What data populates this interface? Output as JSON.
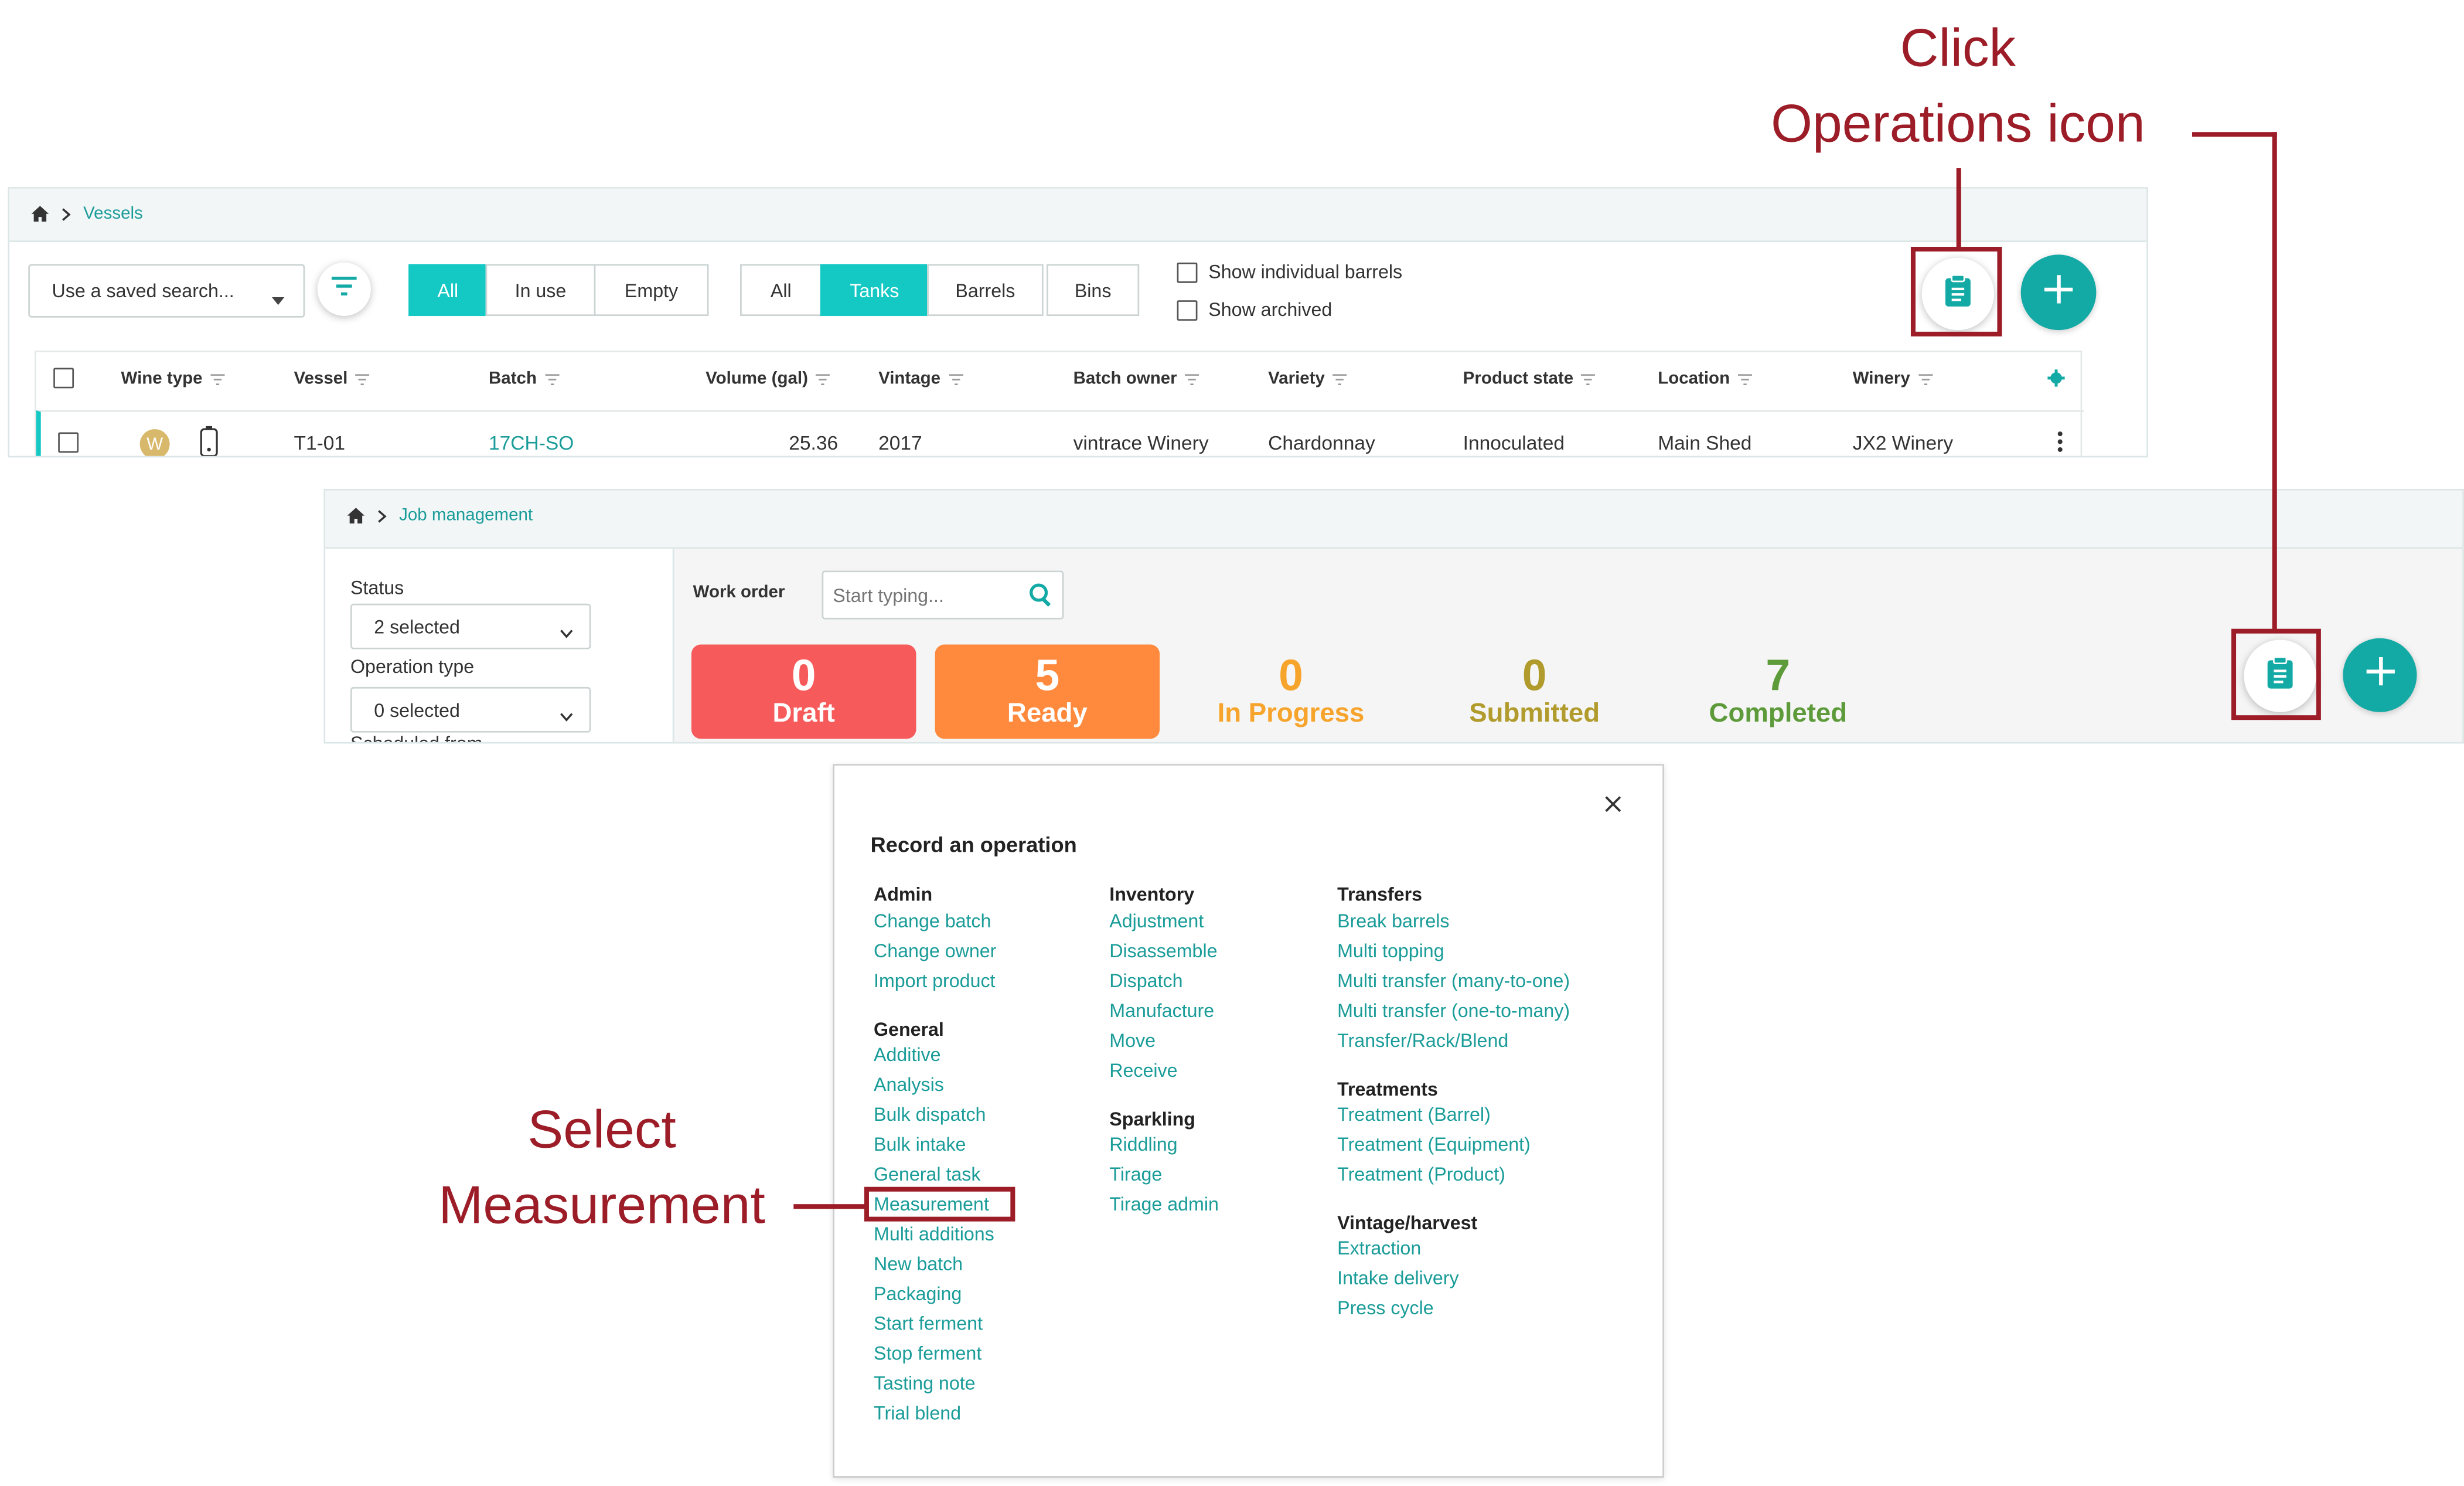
{
  "annotations": {
    "click_line1": "Click",
    "click_line2": "Operations icon",
    "select_line1": "Select",
    "select_line2": "Measurement",
    "color": "#9c1d27"
  },
  "vessels": {
    "breadcrumb": "Vessels",
    "saved_search": "Use a saved search...",
    "filter_group1": [
      "All",
      "In use",
      "Empty"
    ],
    "filter_group2": [
      "All",
      "Tanks",
      "Barrels",
      "Bins"
    ],
    "show_individual_barrels": "Show individual barrels",
    "show_archived": "Show archived",
    "columns": [
      "Wine type",
      "Vessel",
      "Batch",
      "Volume (gal)",
      "Vintage",
      "Batch owner",
      "Variety",
      "Product state",
      "Location",
      "Winery"
    ],
    "row": {
      "wine_badge": "W",
      "vessel": "T1-01",
      "batch": "17CH-SO",
      "volume": "25.36",
      "vintage": "2017",
      "batch_owner": "vintrace Winery",
      "variety": "Chardonnay",
      "product_state": "Innoculated",
      "location": "Main Shed",
      "winery": "JX2 Winery"
    }
  },
  "jobs": {
    "breadcrumb": "Job management",
    "status_label": "Status",
    "status_value": "2 selected",
    "operation_type_label": "Operation type",
    "operation_type_value": "0 selected",
    "scheduled_from_label": "Scheduled from",
    "work_order_label": "Work order",
    "work_order_placeholder": "Start typing...",
    "stats": [
      {
        "count": "0",
        "label": "Draft"
      },
      {
        "count": "5",
        "label": "Ready"
      },
      {
        "count": "0",
        "label": "In Progress"
      },
      {
        "count": "0",
        "label": "Submitted"
      },
      {
        "count": "7",
        "label": "Completed"
      }
    ]
  },
  "modal": {
    "title": "Record an operation",
    "admin": {
      "heading": "Admin",
      "items": [
        "Change batch",
        "Change owner",
        "Import product"
      ]
    },
    "general": {
      "heading": "General",
      "items": [
        "Additive",
        "Analysis",
        "Bulk dispatch",
        "Bulk intake",
        "General task",
        "Measurement",
        "Multi additions",
        "New batch",
        "Packaging",
        "Start ferment",
        "Stop ferment",
        "Tasting note",
        "Trial blend"
      ]
    },
    "inventory": {
      "heading": "Inventory",
      "items": [
        "Adjustment",
        "Disassemble",
        "Dispatch",
        "Manufacture",
        "Move",
        "Receive"
      ]
    },
    "sparkling": {
      "heading": "Sparkling",
      "items": [
        "Riddling",
        "Tirage",
        "Tirage admin"
      ]
    },
    "transfers": {
      "heading": "Transfers",
      "items": [
        "Break barrels",
        "Multi topping",
        "Multi transfer (many-to-one)",
        "Multi transfer (one-to-many)",
        "Transfer/Rack/Blend"
      ]
    },
    "treatments": {
      "heading": "Treatments",
      "items": [
        "Treatment (Barrel)",
        "Treatment (Equipment)",
        "Treatment (Product)"
      ]
    },
    "vintage": {
      "heading": "Vintage/harvest",
      "items": [
        "Extraction",
        "Intake delivery",
        "Press cycle"
      ]
    }
  }
}
